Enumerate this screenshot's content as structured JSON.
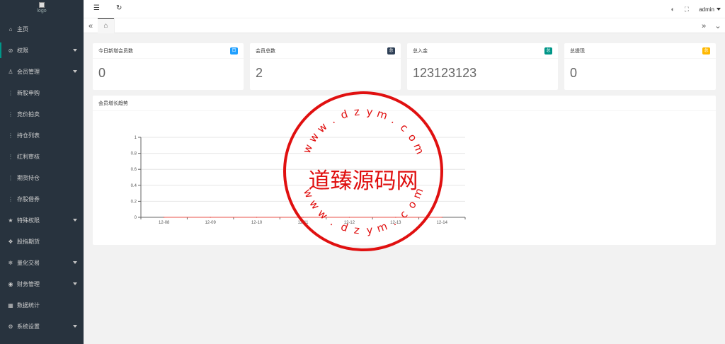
{
  "sidebar": {
    "logo_alt": "logo",
    "items": [
      {
        "label": "主页",
        "icon": "home-icon",
        "glyph": "⌂",
        "has_caret": false,
        "sub": false
      },
      {
        "label": "权限",
        "icon": "shield-icon",
        "glyph": "⊘",
        "has_caret": true,
        "sub": false,
        "active": true
      },
      {
        "label": "会员管理",
        "icon": "user-icon",
        "glyph": "♙",
        "has_caret": true,
        "sub": false
      },
      {
        "label": "新股申购",
        "icon": "sub-item-icon",
        "glyph": "⋮",
        "has_caret": false,
        "sub": true
      },
      {
        "label": "竞价拍卖",
        "icon": "sub-item-icon",
        "glyph": "⋮",
        "has_caret": false,
        "sub": true
      },
      {
        "label": "持仓列表",
        "icon": "sub-item-icon",
        "glyph": "⋮",
        "has_caret": false,
        "sub": true
      },
      {
        "label": "红利审核",
        "icon": "sub-item-icon",
        "glyph": "⋮",
        "has_caret": false,
        "sub": true
      },
      {
        "label": "期货持仓",
        "icon": "sub-item-icon",
        "glyph": "⋮",
        "has_caret": false,
        "sub": true
      },
      {
        "label": "存股借券",
        "icon": "sub-item-icon",
        "glyph": "⋮",
        "has_caret": false,
        "sub": true
      },
      {
        "label": "特殊权限",
        "icon": "star-icon",
        "glyph": "★",
        "has_caret": true,
        "sub": false
      },
      {
        "label": "股指期货",
        "icon": "diamond-icon",
        "glyph": "❖",
        "has_caret": false,
        "sub": false
      },
      {
        "label": "量化交易",
        "icon": "snowflake-icon",
        "glyph": "❄",
        "has_caret": true,
        "sub": false
      },
      {
        "label": "财务管理",
        "icon": "coin-icon",
        "glyph": "◉",
        "has_caret": true,
        "sub": false
      },
      {
        "label": "数据统计",
        "icon": "calendar-icon",
        "glyph": "▦",
        "has_caret": false,
        "sub": false
      },
      {
        "label": "系统设置",
        "icon": "gear-icon",
        "glyph": "⚙",
        "has_caret": true,
        "sub": false
      }
    ]
  },
  "header": {
    "menu_icon": "☰",
    "refresh_icon": "↻",
    "theme_icon": "◐",
    "fullscreen_icon": "⛶",
    "user": "admin"
  },
  "tabs": {
    "left_arrow": "«",
    "right_arrow": "»",
    "dropdown": "⌄",
    "home_glyph": "⌂"
  },
  "stats": [
    {
      "title": "今日新增会员数",
      "badge": "日",
      "badge_color": "#1e9fff",
      "value": "0"
    },
    {
      "title": "会员总数",
      "badge": "总",
      "badge_color": "#2f4056",
      "value": "2"
    },
    {
      "title": "总入金",
      "badge": "总",
      "badge_color": "#009688",
      "value": "123123123"
    },
    {
      "title": "总提现",
      "badge": "总",
      "badge_color": "#ffb800",
      "value": "0"
    }
  ],
  "chart_title": "会员增长趋势",
  "chart_data": {
    "type": "line",
    "title": "",
    "xlabel": "",
    "ylabel": "",
    "x": [
      "12-08",
      "12-09",
      "12-10",
      "12-11",
      "12-12",
      "12-13",
      "12-14"
    ],
    "series": [
      {
        "values": [
          0,
          0,
          0,
          0,
          0,
          0,
          0
        ],
        "color": "#e8524a"
      }
    ],
    "ylim": [
      0,
      1
    ],
    "yticks": [
      "0",
      "0.2",
      "0.4",
      "0.6",
      "0.8",
      "1"
    ],
    "grid": true
  },
  "watermark": {
    "center_text": "道臻源码网",
    "ring_text": "www.dzym.com",
    "color": "#e01010"
  }
}
